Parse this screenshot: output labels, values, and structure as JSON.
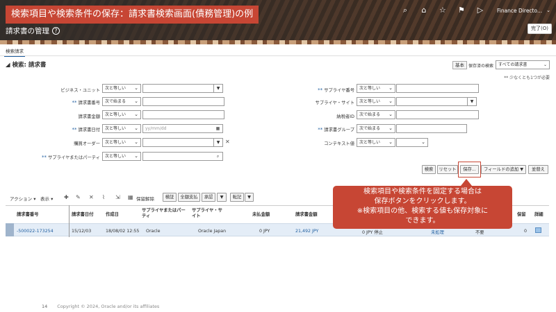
{
  "header": {
    "slide_title": "検索項目や検索条件の保存：請求書検索画面(債務管理)の例",
    "app_title": "請求書の管理",
    "user": "Finance Directo...",
    "done_label": "完了(O)"
  },
  "tabs": [
    {
      "label": "検索請求"
    }
  ],
  "search": {
    "title": "検索: 請求書",
    "basic_label": "基本",
    "saved_label": "保存済の検索",
    "saved_value": "すべての請求書",
    "required_note": "** 少なくとも1つが必要",
    "left_fields": [
      {
        "label": "ビジネス・ユニット",
        "required": false,
        "op": "次と等しい",
        "value": ""
      },
      {
        "label": "請求書番号",
        "required": true,
        "op": "次で始まる",
        "value": ""
      },
      {
        "label": "請求書金額",
        "required": false,
        "op": "次と等しい",
        "value": ""
      },
      {
        "label": "請求書日付",
        "required": true,
        "op": "次と等しい",
        "value": "yy/mm/dd"
      },
      {
        "label": "購買オーダー",
        "required": false,
        "op": "次と等しい",
        "value": ""
      },
      {
        "label": "サプライヤまたはパーティ",
        "required": true,
        "op": "次と等しい",
        "value": ""
      }
    ],
    "right_fields": [
      {
        "label": "サプライヤ番号",
        "required": true,
        "op": "次と等しい",
        "value": ""
      },
      {
        "label": "サプライヤ・サイト",
        "required": false,
        "op": "次と等しい",
        "value": ""
      },
      {
        "label": "納税者ID",
        "required": false,
        "op": "次で始まる",
        "value": ""
      },
      {
        "label": "請求書グループ",
        "required": true,
        "op": "次で始まる",
        "value": ""
      },
      {
        "label": "コンテキスト値",
        "required": false,
        "op": "次と等しい",
        "value": ""
      }
    ],
    "buttons": {
      "search": "検索",
      "reset": "リセット",
      "save": "保存...",
      "add_fields": "フィールドの追加",
      "reorder": "並替え"
    }
  },
  "toolbar": {
    "actions": "アクション",
    "view": "表示",
    "release_hold": "保留解除",
    "validate": "検証",
    "pay_full": "全額支払",
    "approve": "承認",
    "post": "転記"
  },
  "table": {
    "headers": [
      "請求書番号",
      "請求書日付",
      "作成日",
      "サプライヤまたはパーティ",
      "サプライヤ・サイト",
      "未払金額",
      "請求書金額",
      "保留",
      "詳細"
    ],
    "row": {
      "invoice_no": "-500022-173254",
      "invoice_date": "15/12/03",
      "created": "18/08/02 12:55",
      "supplier": "Oracle",
      "site": "Oracle Japan",
      "unpaid": "0 JPY",
      "amount": "21,492 JPY",
      "paid_status": "0 JPY 停止",
      "extra": "未処理",
      "approval": "不要",
      "hold": "0"
    }
  },
  "callout": {
    "line1": "検索項目や検索条件を固定する場合は",
    "line2": "保存ボタンをクリックします。",
    "line3": "※検索項目の他、検索する値も保存対象に",
    "line4": "できます。"
  },
  "footer": {
    "page": "14",
    "copyright": "Copyright © 2024, Oracle and/or its affiliates"
  },
  "colors": {
    "accent": "#c74634",
    "header_bg": "#312d2a",
    "link": "#1f5ea0"
  }
}
